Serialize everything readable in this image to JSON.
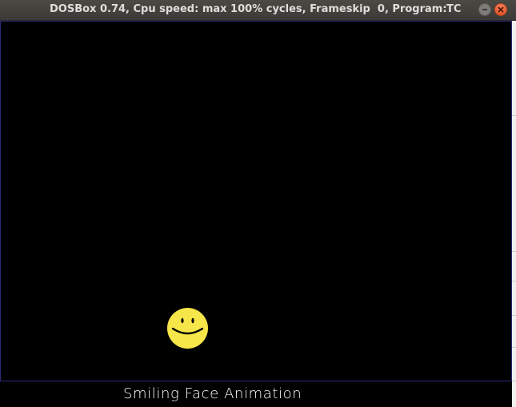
{
  "window": {
    "title": "DOSBox 0.74, Cpu speed: max 100% cycles, Frameskip  0, Program:",
    "title_suffix": "TC",
    "controls": {
      "minimize_icon": "minimize-icon",
      "close_icon": "close-icon"
    }
  },
  "screen": {
    "background_color": "#000000",
    "sprite": {
      "icon": "smiley-face-icon",
      "fill_color": "#f7e64a",
      "stroke_color": "#000000"
    }
  },
  "caption": {
    "text": "Smiling Face Animation",
    "color": "#ffffff"
  }
}
